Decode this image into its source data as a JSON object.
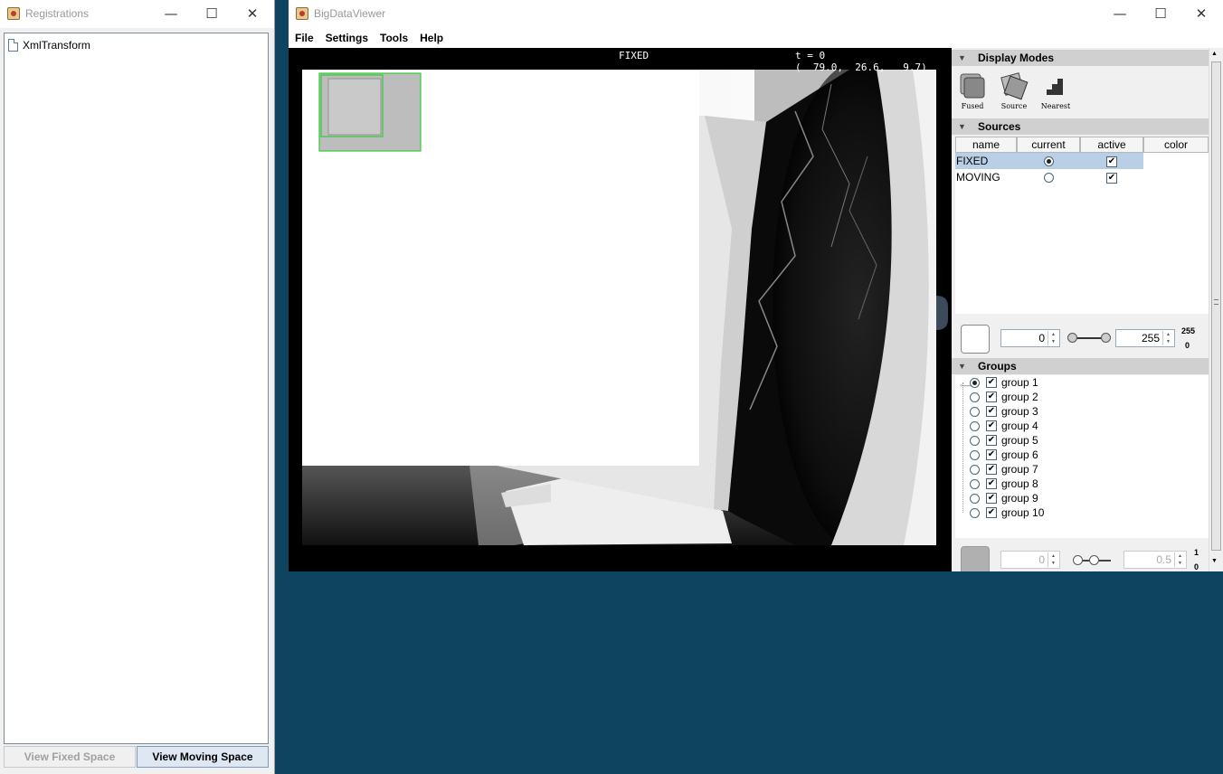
{
  "registrations": {
    "title": "Registrations",
    "tree_items": [
      "XmlTransform"
    ],
    "buttons": {
      "view_fixed": "View Fixed Space",
      "view_moving": "View Moving Space"
    }
  },
  "bdv": {
    "title": "BigDataViewer",
    "menu": [
      "File",
      "Settings",
      "Tools",
      "Help"
    ],
    "viewer": {
      "source_label": "FIXED",
      "time_label": "t = 0",
      "coords_label": "(  79.0,  26.6,   9.7)"
    },
    "display_modes": {
      "header": "Display Modes",
      "modes": [
        "Fused",
        "Source",
        "Nearest"
      ]
    },
    "sources": {
      "header": "Sources",
      "columns": [
        "name",
        "current",
        "active",
        "color"
      ],
      "rows": [
        {
          "name": "FIXED",
          "current": true,
          "active": true
        },
        {
          "name": "MOVING",
          "current": false,
          "active": true
        }
      ],
      "min_value": "0",
      "max_value": "255",
      "range_max": "255",
      "range_min": "0"
    },
    "groups": {
      "header": "Groups",
      "items": [
        "group 1",
        "group 2",
        "group 3",
        "group 4",
        "group 5",
        "group 6",
        "group 7",
        "group 8",
        "group 9",
        "group 10"
      ],
      "min_value": "0",
      "max_value": "0.5",
      "range_max": "1",
      "range_min": "0"
    }
  },
  "colors": {
    "desktop": "#0f4460",
    "selection": "#b8cfe5",
    "overview_border": "#33cc33"
  }
}
